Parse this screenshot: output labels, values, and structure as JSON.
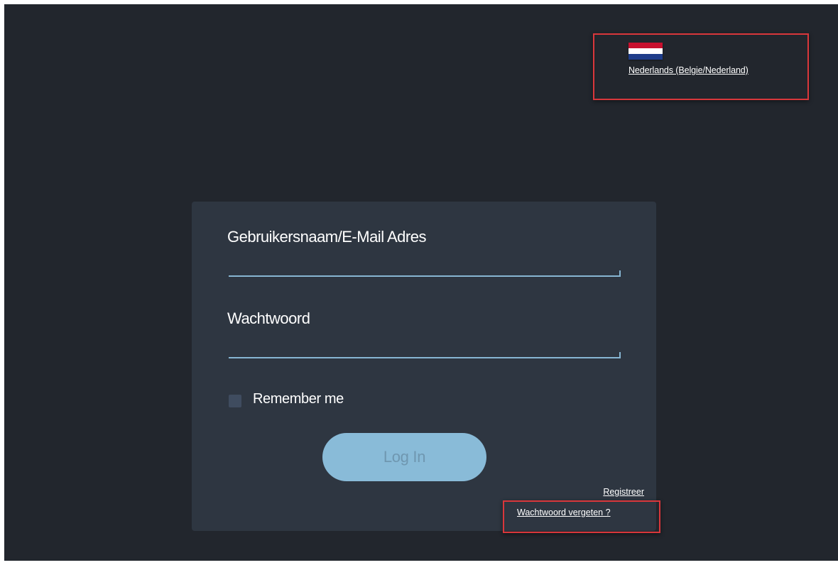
{
  "language": {
    "flag_icon": "netherlands-flag-icon",
    "label": "Nederlands (Belgie/Nederland)"
  },
  "login_form": {
    "username_label": "Gebruikersnaam/E-Mail Adres",
    "username_value": "",
    "password_label": "Wachtwoord",
    "password_value": "",
    "remember_label": "Remember me",
    "remember_checked": false,
    "login_button": "Log In",
    "register_link": "Registreer",
    "forgot_link": "Wachtwoord vergeten ?"
  },
  "colors": {
    "background": "#22262d",
    "card": "#2e3641",
    "accent": "#89bbd8",
    "highlight": "#d9373b"
  }
}
